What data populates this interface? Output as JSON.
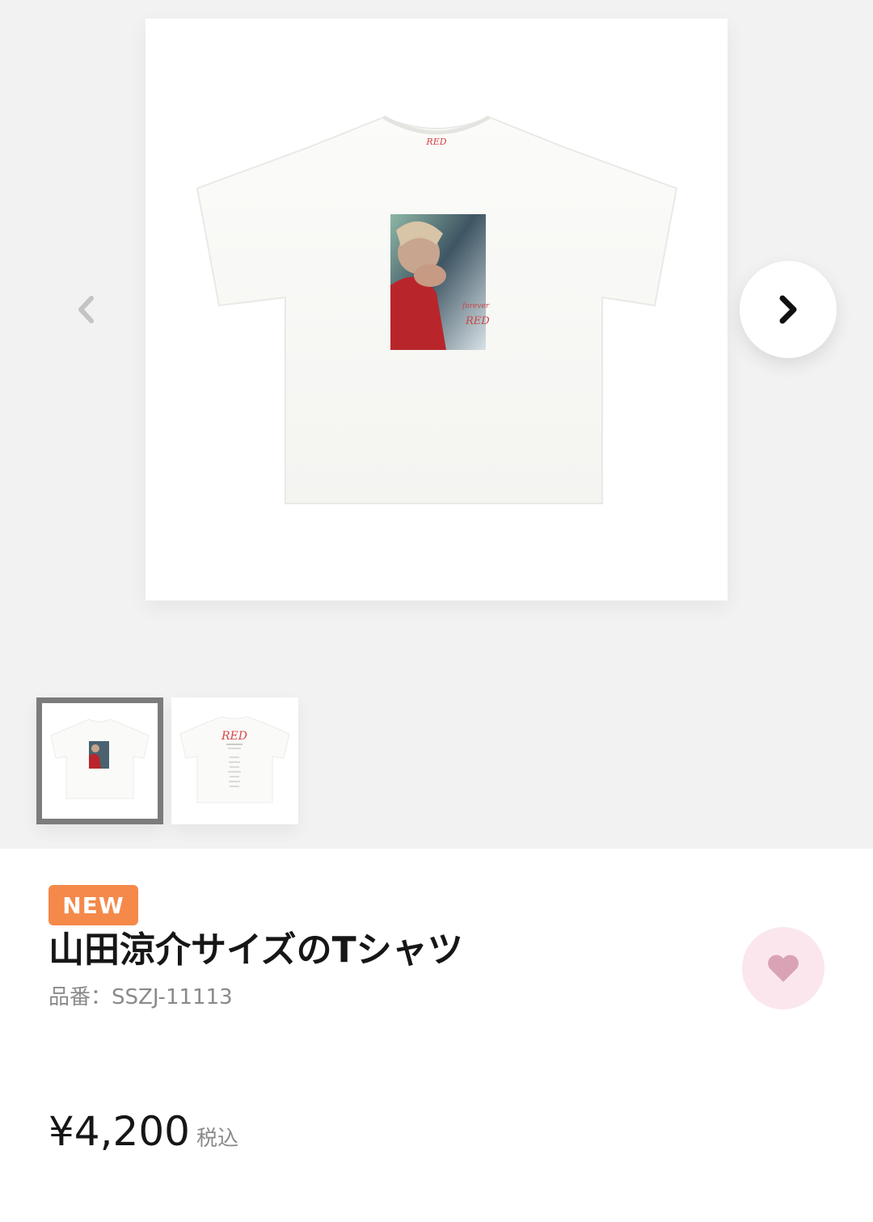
{
  "product": {
    "badge": "NEW",
    "title": "山田涼介サイズのTシャツ",
    "sku": "品番：SSZJ-11113",
    "price": "¥4,200",
    "tax_label": "税込",
    "print_text": {
      "brand_tag": "RED",
      "script_line": "forever",
      "script_word": "RED"
    }
  },
  "gallery": {
    "thumbnails": [
      {
        "name": "front",
        "active": true
      },
      {
        "name": "back",
        "active": false,
        "print_title": "RED"
      }
    ]
  },
  "colors": {
    "badge": "#f4894a",
    "favorite_bg": "#fbe6ee",
    "favorite_heart": "#d9a3b5",
    "gallery_bg": "#f2f2f2",
    "thumb_active_border": "#7c7c7c"
  },
  "icons": {
    "prev": "chevron-left-icon",
    "next": "chevron-right-icon",
    "favorite": "heart-icon"
  }
}
